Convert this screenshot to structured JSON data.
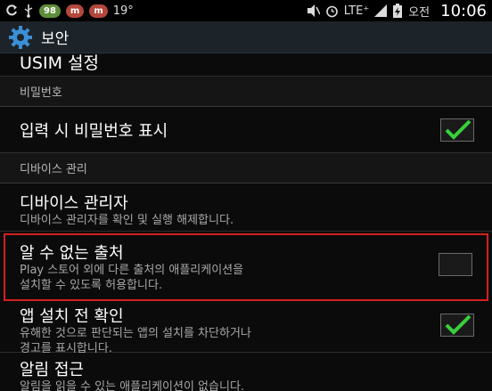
{
  "status_bar": {
    "battery_pill": "98",
    "msg_pill_1": "m",
    "msg_pill_2": "m",
    "temperature": "19°",
    "network": "LTE⁺",
    "ampm": "오전",
    "time": "10:06"
  },
  "action_bar": {
    "title": "보안",
    "icon": "gear-icon"
  },
  "rows": {
    "usim": "USIM 설정",
    "section_password": "비밀번호",
    "show_password": {
      "title": "입력 시 비밀번호 표시",
      "checked": true
    },
    "section_device": "디바이스 관리",
    "device_admin": {
      "title": "디바이스 관리자",
      "subtitle": "디바이스 관리자를 확인 및 실행 해제합니다."
    },
    "unknown_sources": {
      "title": "알 수 없는 출처",
      "subtitle_line1": "Play 스토어 외에 다른 출처의 애플리케이션을",
      "subtitle_line2": "설치할 수 있도록 허용합니다.",
      "checked": false
    },
    "verify_apps": {
      "title": "앱 설치 전 확인",
      "subtitle_line1": "유해한 것으로 판단되는 앱의 설치를 차단하거나",
      "subtitle_line2": "경고를 표시합니다.",
      "checked": true
    },
    "notification_access": {
      "title": "알림 접근",
      "subtitle": "알림을 읽을 수 있는 애플리케이션이 없습니다."
    }
  },
  "colors": {
    "accent_check": "#38d03a",
    "highlight_border": "#d62020"
  }
}
